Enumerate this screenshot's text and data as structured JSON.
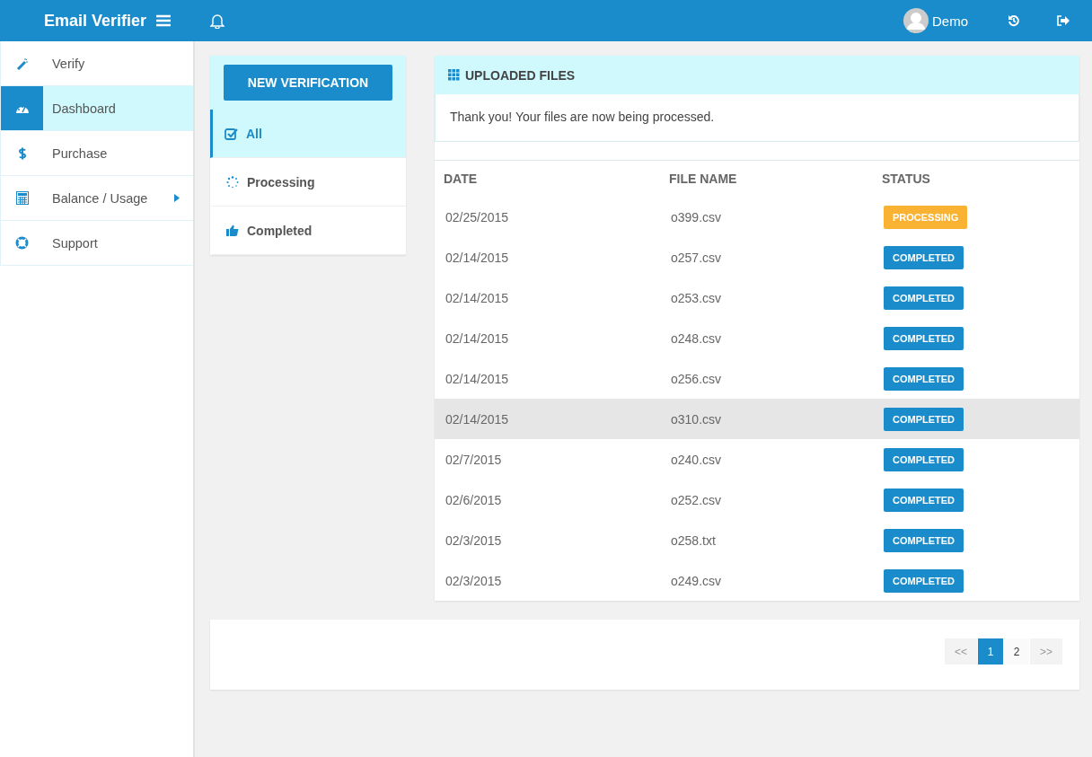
{
  "topbar": {
    "title": "Email Verifier",
    "user": "Demo"
  },
  "sidebar": {
    "items": [
      {
        "label": "Verify",
        "selected": false,
        "submenu": false
      },
      {
        "label": "Dashboard",
        "selected": true,
        "submenu": false
      },
      {
        "label": "Purchase",
        "selected": false,
        "submenu": false
      },
      {
        "label": "Balance / Usage",
        "selected": false,
        "submenu": true
      },
      {
        "label": "Support",
        "selected": false,
        "submenu": false
      }
    ]
  },
  "filters": {
    "button": "NEW VERIFICATION",
    "items": [
      {
        "label": "All",
        "selected": true
      },
      {
        "label": "Processing",
        "selected": false
      },
      {
        "label": "Completed",
        "selected": false
      }
    ]
  },
  "files": {
    "title": "UPLOADED FILES",
    "message": "Thank you! Your files are now being processed.",
    "columns": [
      "DATE",
      "FILE NAME",
      "STATUS"
    ],
    "rows": [
      {
        "date": "02/25/2015",
        "file": "o399.csv",
        "status": "PROCESSING",
        "kind": "processing",
        "selected": false
      },
      {
        "date": "02/14/2015",
        "file": "o257.csv",
        "status": "COMPLETED",
        "kind": "completed",
        "selected": false
      },
      {
        "date": "02/14/2015",
        "file": "o253.csv",
        "status": "COMPLETED",
        "kind": "completed",
        "selected": false
      },
      {
        "date": "02/14/2015",
        "file": "o248.csv",
        "status": "COMPLETED",
        "kind": "completed",
        "selected": false
      },
      {
        "date": "02/14/2015",
        "file": "o256.csv",
        "status": "COMPLETED",
        "kind": "completed",
        "selected": false
      },
      {
        "date": "02/14/2015",
        "file": "o310.csv",
        "status": "COMPLETED",
        "kind": "completed",
        "selected": true
      },
      {
        "date": "02/7/2015",
        "file": "o240.csv",
        "status": "COMPLETED",
        "kind": "completed",
        "selected": false
      },
      {
        "date": "02/6/2015",
        "file": "o252.csv",
        "status": "COMPLETED",
        "kind": "completed",
        "selected": false
      },
      {
        "date": "02/3/2015",
        "file": "o258.txt",
        "status": "COMPLETED",
        "kind": "completed",
        "selected": false
      },
      {
        "date": "02/3/2015",
        "file": "o249.csv",
        "status": "COMPLETED",
        "kind": "completed",
        "selected": false
      }
    ]
  },
  "pagination": {
    "items": [
      {
        "label": "<<",
        "selected": false
      },
      {
        "label": "1",
        "selected": true
      },
      {
        "label": "2",
        "selected": false
      },
      {
        "label": ">>",
        "selected": false
      }
    ]
  }
}
